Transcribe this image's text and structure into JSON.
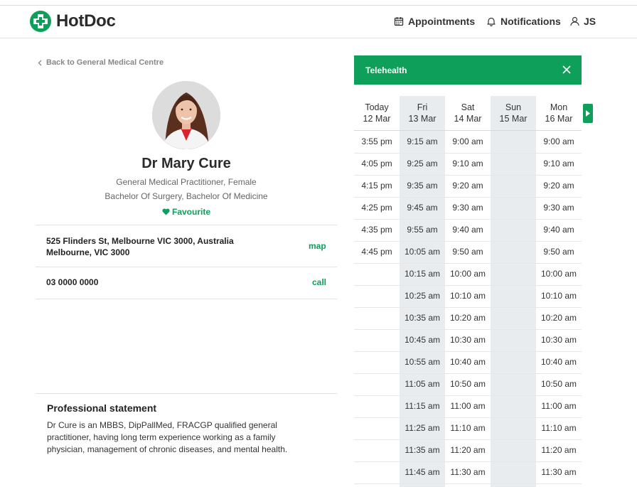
{
  "header": {
    "brand": "HotDoc",
    "nav": {
      "appointments": "Appointments",
      "notifications": "Notifications",
      "user": "JS"
    }
  },
  "colors": {
    "accent": "#0e9f5a"
  },
  "profile": {
    "back_label": "Back to General Medical Centre",
    "name": "Dr Mary Cure",
    "subtitle1": "General Medical Practitioner, Female",
    "subtitle2": "Bachelor Of Surgery, Bachelor Of Medicine",
    "favourite_label": "Favourite",
    "address_line1": "525 Flinders St, Melbourne VIC 3000, Australia",
    "address_line2": "Melbourne, VIC 3000",
    "map_label": "map",
    "phone": "03 0000 0000",
    "call_label": "call",
    "statement_title": "Professional statement",
    "statement_body": "Dr Cure is an MBBS, DipPallMed, FRACGP qualified general practitioner, having long term experience working as a family physician, management of chronic diseases, and mental health."
  },
  "booking": {
    "mode_label": "Telehealth",
    "icons": {
      "close": "close-icon",
      "next": "next-arrow-icon"
    },
    "days": [
      {
        "day": "Today",
        "date": "12 Mar",
        "shaded": false,
        "slots": [
          "3:55 pm",
          "4:05 pm",
          "4:15 pm",
          "4:25 pm",
          "4:35 pm",
          "4:45 pm"
        ]
      },
      {
        "day": "Fri",
        "date": "13 Mar",
        "shaded": true,
        "slots": [
          "9:15 am",
          "9:25 am",
          "9:35 am",
          "9:45 am",
          "9:55 am",
          "10:05 am",
          "10:15 am",
          "10:25 am",
          "10:35 am",
          "10:45 am",
          "10:55 am",
          "11:05 am",
          "11:15 am",
          "11:25 am",
          "11:35 am",
          "11:45 am"
        ]
      },
      {
        "day": "Sat",
        "date": "14 Mar",
        "shaded": false,
        "slots": [
          "9:00 am",
          "9:10 am",
          "9:20 am",
          "9:30 am",
          "9:40 am",
          "9:50 am",
          "10:00 am",
          "10:10 am",
          "10:20 am",
          "10:30 am",
          "10:40 am",
          "10:50 am",
          "11:00 am",
          "11:10 am",
          "11:20 am",
          "11:30 am"
        ]
      },
      {
        "day": "Sun",
        "date": "15 Mar",
        "shaded": true,
        "slots": []
      },
      {
        "day": "Mon",
        "date": "16 Mar",
        "shaded": false,
        "slots": [
          "9:00 am",
          "9:10 am",
          "9:20 am",
          "9:30 am",
          "9:40 am",
          "9:50 am",
          "10:00 am",
          "10:10 am",
          "10:20 am",
          "10:30 am",
          "10:40 am",
          "10:50 am",
          "11:00 am",
          "11:10 am",
          "11:20 am",
          "11:30 am"
        ]
      }
    ]
  }
}
